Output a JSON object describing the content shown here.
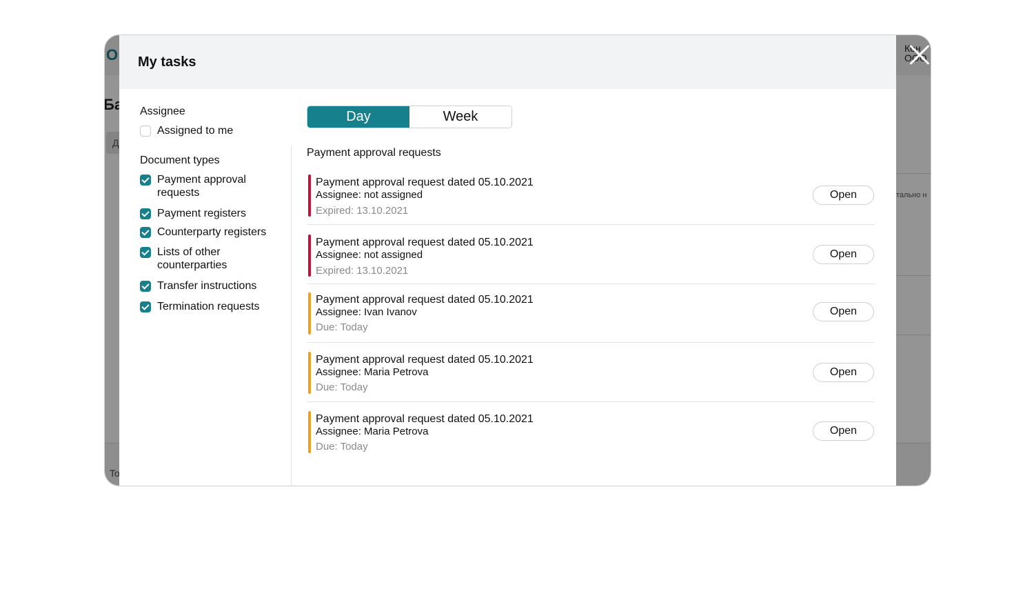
{
  "background": {
    "logo": "O",
    "title": "Ба",
    "chip": "Д",
    "user_line1": "Кон",
    "user_line2": "ООО",
    "side_text": "тально н",
    "footer_text": "To"
  },
  "modal": {
    "title": "My tasks"
  },
  "filters": {
    "assignee_title": "Assignee",
    "assigned_to_me": {
      "label": "Assigned to me",
      "checked": false
    },
    "doc_types_title": "Document types",
    "doc_types": [
      {
        "label": "Payment approval requests",
        "checked": true
      },
      {
        "label": "Payment registers",
        "checked": true
      },
      {
        "label": "Counterparty registers",
        "checked": true
      },
      {
        "label": "Lists of other counterparties",
        "checked": true
      },
      {
        "label": "Transfer instructions",
        "checked": true
      },
      {
        "label": "Termination requests",
        "checked": true
      }
    ]
  },
  "period": {
    "day_label": "Day",
    "week_label": "Week",
    "selected": "Day"
  },
  "section_title": "Payment approval requests",
  "open_label": "Open",
  "colors": {
    "accent": "#16808c",
    "expired": "#c0143c",
    "due": "#f0a020"
  },
  "tasks": [
    {
      "title": "Payment approval request dated 05.10.2021",
      "assignee": "Assignee: not assigned",
      "date": "Expired: 13.10.2021",
      "status": "expired"
    },
    {
      "title": "Payment approval request dated 05.10.2021",
      "assignee": "Assignee: not assigned",
      "date": "Expired: 13.10.2021",
      "status": "expired"
    },
    {
      "title": "Payment approval request dated 05.10.2021",
      "assignee": "Assignee: Ivan Ivanov",
      "date": "Due: Today",
      "status": "due"
    },
    {
      "title": "Payment approval request dated 05.10.2021",
      "assignee": "Assignee: Maria Petrova",
      "date": "Due: Today",
      "status": "due"
    },
    {
      "title": "Payment approval request dated 05.10.2021",
      "assignee": "Assignee: Maria Petrova",
      "date": "Due: Today",
      "status": "due"
    }
  ]
}
